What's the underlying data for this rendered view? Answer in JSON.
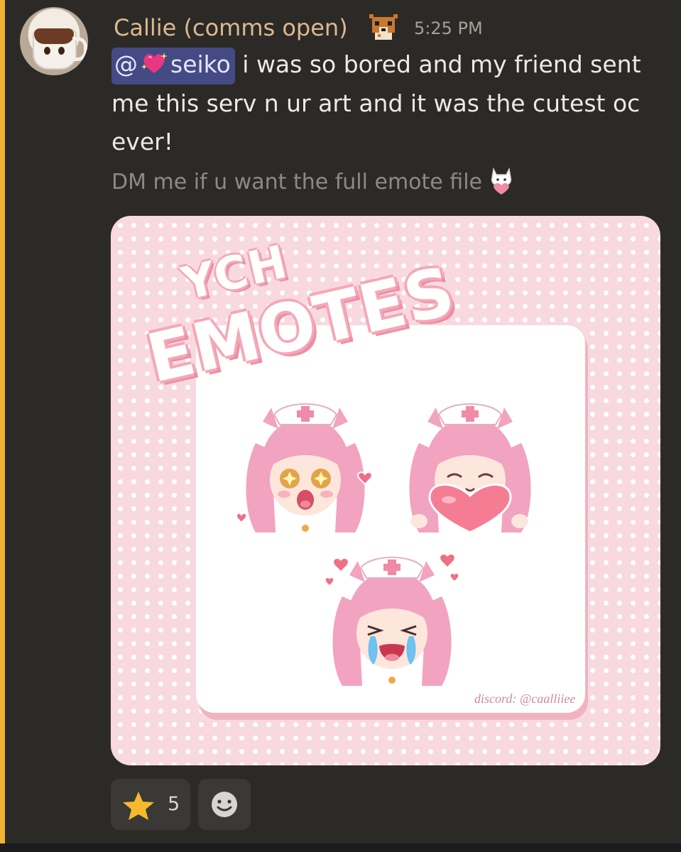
{
  "message": {
    "author": "Callie (comms open)",
    "timestamp": "5:25 PM",
    "mention": {
      "prefix": "@",
      "name": "seiko"
    },
    "body_text": " i was so bored and my friend sent me this serv n ur art and it was the cutest oc ever!",
    "subtext": "DM me if u want the full emote file"
  },
  "attachment": {
    "title_line1": "YCH",
    "title_line2": "EMOTES",
    "credit": "discord: @caalliiee",
    "colors": {
      "background": "#f8d9df",
      "dots": "#ffffff",
      "accent_pink": "#f4a8b8"
    }
  },
  "reactions": [
    {
      "icon": "star-icon",
      "count": "5"
    },
    {
      "icon": "add-reaction-smile-icon"
    }
  ],
  "colors": {
    "highlight_bar": "#f0b232",
    "username": "#dbb98d",
    "mention_bg": "#444a83"
  }
}
